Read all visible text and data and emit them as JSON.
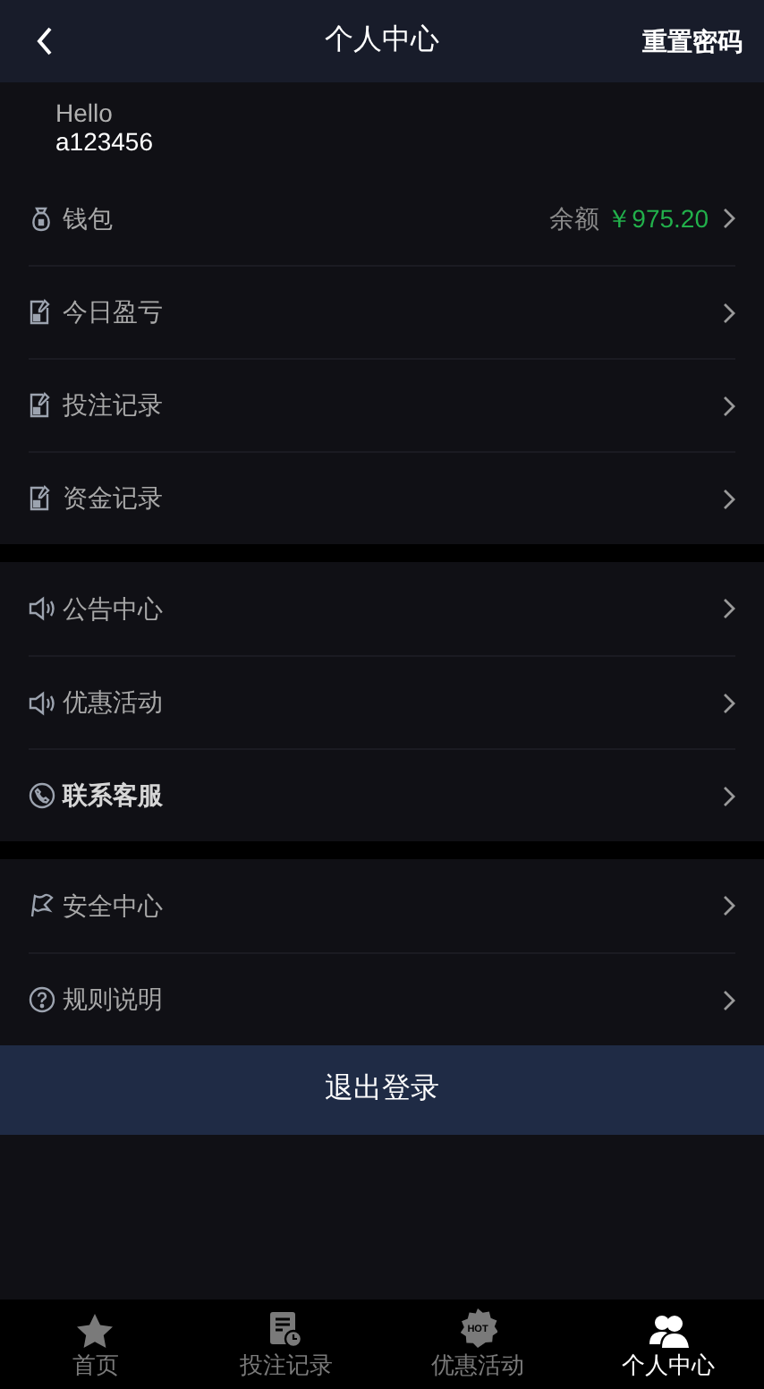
{
  "header": {
    "title": "个人中心",
    "action": "重置密码"
  },
  "user": {
    "greeting": "Hello",
    "username": "a123456"
  },
  "groups": [
    {
      "items": [
        {
          "kind": "wallet",
          "label": "钱包",
          "emphasized": false,
          "balance_label": "余额",
          "balance": "￥975.20"
        },
        {
          "kind": "document",
          "label": "今日盈亏",
          "emphasized": false
        },
        {
          "kind": "document",
          "label": "投注记录",
          "emphasized": false
        },
        {
          "kind": "document",
          "label": "资金记录",
          "emphasized": false
        }
      ]
    },
    {
      "items": [
        {
          "kind": "speaker",
          "label": "公告中心",
          "emphasized": false
        },
        {
          "kind": "speaker",
          "label": "优惠活动",
          "emphasized": false
        },
        {
          "kind": "phone",
          "label": "联系客服",
          "emphasized": true
        }
      ]
    },
    {
      "items": [
        {
          "kind": "flag",
          "label": "安全中心",
          "emphasized": false
        },
        {
          "kind": "question",
          "label": "规则说明",
          "emphasized": false
        }
      ]
    }
  ],
  "logout_button": "退出登录",
  "tab_bar": [
    {
      "kind": "star",
      "label": "首页",
      "selected": false
    },
    {
      "kind": "clock-doc",
      "label": "投注记录",
      "selected": false
    },
    {
      "kind": "hot",
      "label": "优惠活动",
      "selected": false,
      "icon_text": "HOT"
    },
    {
      "kind": "users",
      "label": "个人中心",
      "selected": true
    }
  ]
}
